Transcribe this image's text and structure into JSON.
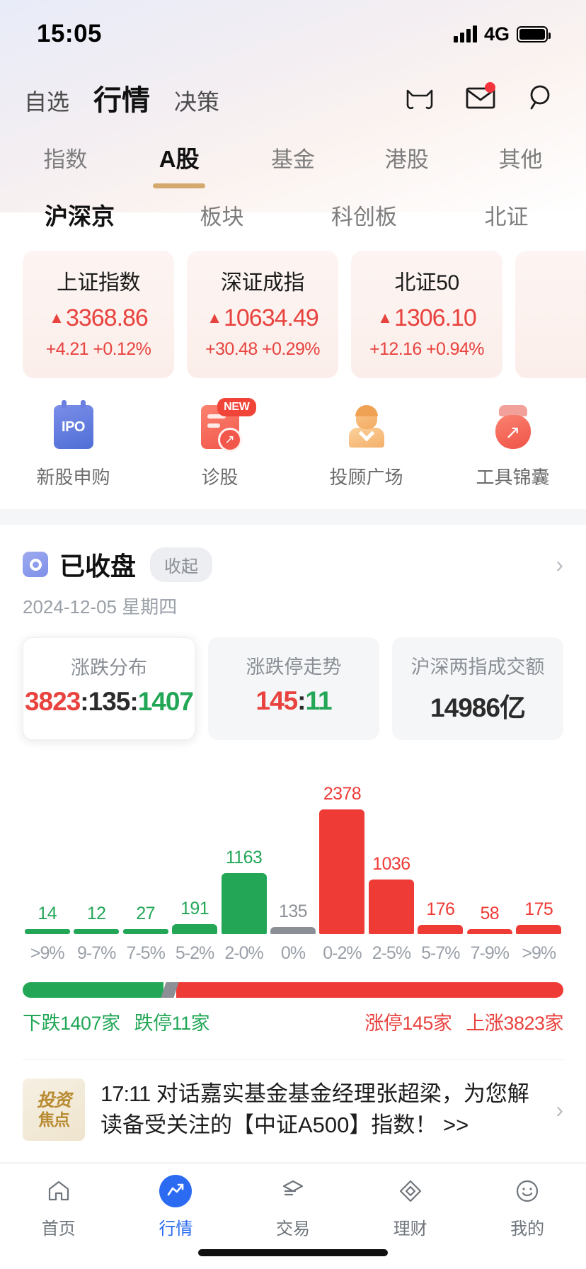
{
  "status_bar": {
    "time": "15:05",
    "network": "4G",
    "signal_icon": "signal-bars-icon",
    "battery_icon": "battery-full-icon"
  },
  "header": {
    "tabs": [
      {
        "label": "自选",
        "active": false
      },
      {
        "label": "行情",
        "active": true
      },
      {
        "label": "决策",
        "active": false
      }
    ],
    "icons": [
      {
        "name": "cat-face-icon"
      },
      {
        "name": "mail-icon",
        "badge": true
      },
      {
        "name": "search-icon"
      }
    ]
  },
  "main_tabs": [
    {
      "label": "指数",
      "active": false
    },
    {
      "label": "A股",
      "active": true
    },
    {
      "label": "基金",
      "active": false
    },
    {
      "label": "港股",
      "active": false
    },
    {
      "label": "其他",
      "active": false
    }
  ],
  "sub_tabs": [
    {
      "label": "沪深京",
      "active": true
    },
    {
      "label": "板块",
      "active": false
    },
    {
      "label": "科创板",
      "active": false
    },
    {
      "label": "北证",
      "active": false
    }
  ],
  "index_cards": [
    {
      "name": "上证指数",
      "value": "3368.86",
      "change": "+4.21",
      "percent": "+0.12%",
      "direction": "up",
      "caret": "▲"
    },
    {
      "name": "深证成指",
      "value": "10634.49",
      "change": "+30.48",
      "percent": "+0.29%",
      "direction": "up",
      "caret": "▲"
    },
    {
      "name": "北证50",
      "value": "1306.10",
      "change": "+12.16",
      "percent": "+0.94%",
      "direction": "up",
      "caret": "▲"
    },
    {
      "name": "",
      "value": "",
      "change": "+",
      "percent": "",
      "direction": "up",
      "caret": "▲"
    }
  ],
  "quick_actions": [
    {
      "label": "新股申购",
      "icon": "ipo-calendar-icon",
      "badge": ""
    },
    {
      "label": "诊股",
      "icon": "diagnose-stock-icon",
      "badge": "NEW"
    },
    {
      "label": "投顾广场",
      "icon": "advisor-person-icon",
      "badge": ""
    },
    {
      "label": "工具锦囊",
      "icon": "money-bag-icon",
      "badge": ""
    }
  ],
  "market": {
    "status_title": "已收盘",
    "collapse_label": "收起",
    "date": "2024-12-05 星期四",
    "status_icon": "market-status-icon",
    "chevron_icon": "chevron-right-icon"
  },
  "stat_cards": [
    {
      "title": "涨跌分布",
      "selected": true,
      "parts": [
        {
          "text": "3823",
          "color": "up"
        },
        {
          "text": ":",
          "color": "sep"
        },
        {
          "text": "135",
          "color": "flat"
        },
        {
          "text": ":",
          "color": "sep"
        },
        {
          "text": "1407",
          "color": "down"
        }
      ]
    },
    {
      "title": "涨跌停走势",
      "selected": false,
      "parts": [
        {
          "text": "145",
          "color": "up"
        },
        {
          "text": ":",
          "color": "sep"
        },
        {
          "text": "11",
          "color": "down"
        }
      ]
    },
    {
      "title": "沪深两指成交额",
      "selected": false,
      "parts": [
        {
          "text": "14986亿",
          "color": "flat"
        }
      ]
    }
  ],
  "chart_data": {
    "type": "bar",
    "title": "涨跌分布",
    "xlabel": "",
    "ylabel": "",
    "grid": false,
    "legend_position": "none",
    "ylim": [
      0,
      2378
    ],
    "categories": [
      ">9%",
      "9-7%",
      "7-5%",
      "5-2%",
      "2-0%",
      "0%",
      "0-2%",
      "2-5%",
      "5-7%",
      "7-9%",
      ">9%"
    ],
    "values": [
      14,
      12,
      27,
      191,
      1163,
      135,
      2378,
      1036,
      176,
      58,
      175
    ],
    "colors": [
      "#23a757",
      "#23a757",
      "#23a757",
      "#23a757",
      "#23a757",
      "#8c9096",
      "#ef3b36",
      "#ef3b36",
      "#ef3b36",
      "#ef3b36",
      "#ef3b36"
    ],
    "label_colors": [
      "#23a757",
      "#23a757",
      "#23a757",
      "#23a757",
      "#23a757",
      "#8c9096",
      "#ef3b36",
      "#ef3b36",
      "#ef3b36",
      "#ef3b36",
      "#ef3b36"
    ]
  },
  "distribution": {
    "down_pct": 26.0,
    "flat_pct": 2.4,
    "up_pct": 71.6,
    "left_legend": [
      {
        "text": "下跌1407家",
        "color": "g"
      },
      {
        "text": "跌停11家",
        "color": "g"
      }
    ],
    "right_legend": [
      {
        "text": "涨停145家",
        "color": "r"
      },
      {
        "text": "上涨3823家",
        "color": "r"
      }
    ]
  },
  "news": {
    "logo_line1": "投资",
    "logo_line2": "焦点",
    "time": "17:11",
    "text": " 对话嘉实基金基金经理张超梁，为您解读备受关注的【中证A500】指数！ >>",
    "chevron_icon": "chevron-right-icon"
  },
  "tabbar": [
    {
      "label": "首页",
      "icon": "home-icon",
      "active": false
    },
    {
      "label": "行情",
      "icon": "quotes-icon",
      "active": true
    },
    {
      "label": "交易",
      "icon": "trade-icon",
      "active": false
    },
    {
      "label": "理财",
      "icon": "finance-icon",
      "active": false
    },
    {
      "label": "我的",
      "icon": "profile-icon",
      "active": false
    }
  ],
  "watermark": "᎐ ᎐ ᎐᎐ ᎐ ᎐"
}
